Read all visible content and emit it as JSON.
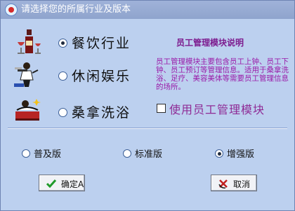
{
  "window": {
    "title": "请选择您的所属行业及版本"
  },
  "industries": [
    {
      "label": "餐饮行业",
      "icon": "wine-dining-icon",
      "selected": true
    },
    {
      "label": "休闲娱乐",
      "icon": "waiter-icon",
      "selected": false
    },
    {
      "label": "桑拿洗浴",
      "icon": "bath-icon",
      "selected": false
    }
  ],
  "info": {
    "title": "员工管理模块说明",
    "text": "员工管理模块主要包含员工上钟、员工下钟、员工预订等管理信息。适用于桑拿洗浴、足疗、美容美体等需要员工管理信息的场所。"
  },
  "employee_module": {
    "label": "使用员工管理模块",
    "checked": false
  },
  "editions": [
    {
      "label": "普及版",
      "selected": false
    },
    {
      "label": "标准版",
      "selected": false
    },
    {
      "label": "增强版",
      "selected": true
    }
  ],
  "buttons": {
    "ok": {
      "label": "确定A",
      "icon": "checkmark-icon"
    },
    "cancel": {
      "label": "取消",
      "icon": "cancel-icon"
    }
  },
  "colors": {
    "info_text": "#9a1aa8",
    "title_bar": "#8fa4cd",
    "background": "#bcd0ef"
  }
}
